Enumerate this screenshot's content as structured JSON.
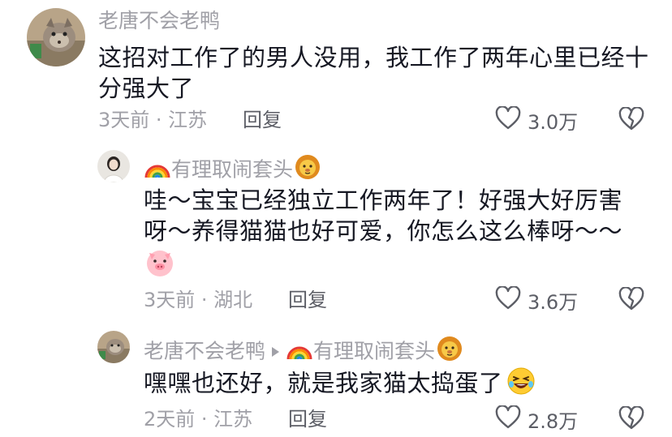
{
  "comments": [
    {
      "author": "老唐不会老鸭",
      "text": "这招对工作了的男人没用，我工作了两年心里已经十分强大了",
      "meta": "3天前 · 江苏",
      "reply_label": "回复",
      "likes": "3.0万"
    },
    {
      "author_prefix_emoji": "rainbow-emoji",
      "author": "有理取闹套头",
      "author_suffix_emoji": "lion-emoji",
      "text": "哇～宝宝已经独立工作两年了！好强大好厉害呀～养得猫猫也好可爱，你怎么这么棒呀～～",
      "trailing_emoji": "pig-emoji",
      "meta": "3天前 · 湖北",
      "reply_label": "回复",
      "likes": "3.6万"
    },
    {
      "author": "老唐不会老鸭",
      "reply_to_prefix_emoji": "rainbow-emoji",
      "reply_to": "有理取闹套头",
      "reply_to_suffix_emoji": "lion-emoji",
      "text": "嘿嘿也还好，就是我家猫太捣蛋了",
      "trailing_emoji": "laughing-emoji",
      "meta": "2天前 · 江苏",
      "reply_label": "回复",
      "likes": "2.8万"
    }
  ],
  "colors": {
    "secondary_text": "#a0a0a7",
    "primary_text": "#161823",
    "action_text": "#5c5e66"
  }
}
